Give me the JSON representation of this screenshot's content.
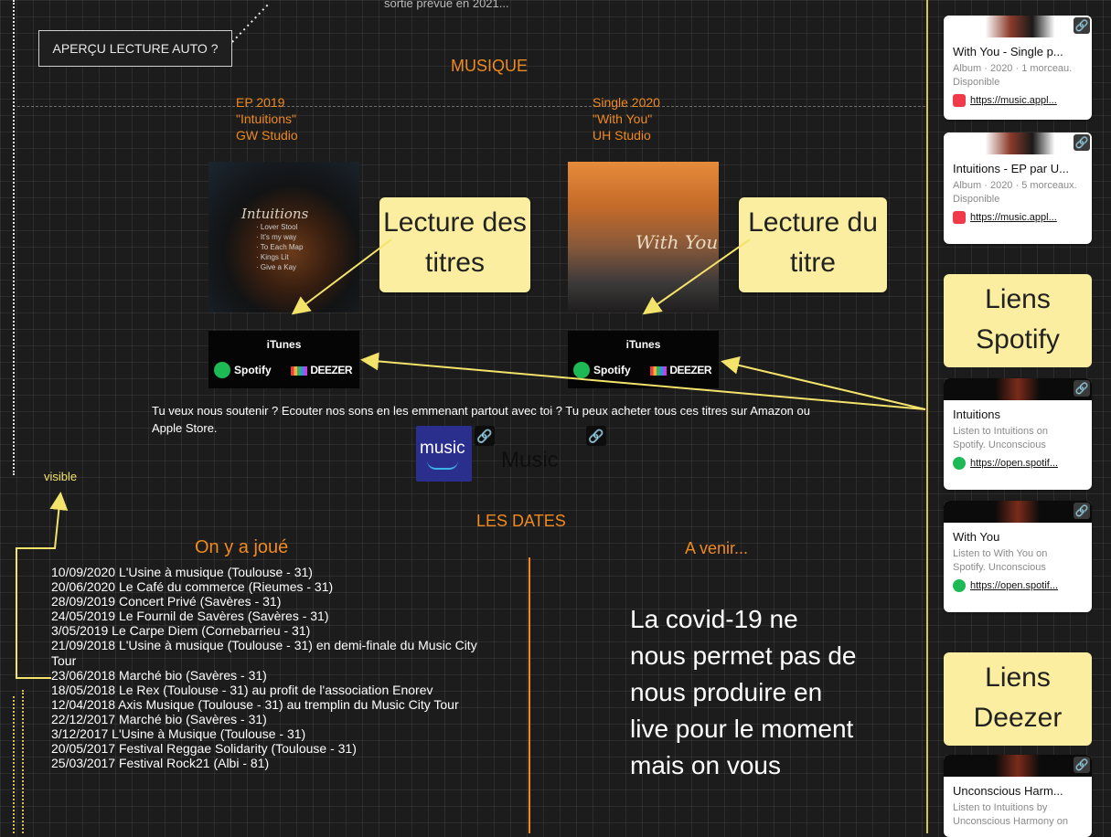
{
  "top_cut_text": "sortie prévue en 2021...",
  "autoplay": {
    "label": "APERÇU LECTURE AUTO ?"
  },
  "music": {
    "title": "MUSIQUE",
    "releases": [
      {
        "line1": "EP 2019",
        "line2": "\"Intuitions\"",
        "line3": "GW Studio",
        "cover_title": "Intuitions",
        "tracks": [
          "· Lover Stool",
          "· It's my way",
          "· To Each Map",
          "· Kings Lit",
          "· Give a Kay"
        ]
      },
      {
        "line1": "Single 2020",
        "line2": "\"With You\"",
        "line3": "UH Studio",
        "cover_title": "With You"
      }
    ],
    "stores": {
      "itunes": "iTunes",
      "spotify": "Spotify",
      "deezer": "DEEZER"
    },
    "callouts": {
      "left": "Lecture des titres",
      "right": "Lecture du titre"
    },
    "support_text": "Tu veux nous soutenir ? Ecouter nos sons en les emmenant partout avec toi ? Tu peux acheter tous ces titres sur Amazon ou Apple Store.",
    "amazon_label": "music",
    "apple_label": "Music"
  },
  "visible_label": "visible",
  "dates": {
    "title": "LES DATES",
    "played_title": "On y a joué",
    "upcoming_title": "A venir...",
    "played": [
      "10/09/2020 L'Usine à musique (Toulouse - 31)",
      "20/06/2020 Le Café du commerce (Rieumes - 31)",
      "28/09/2019 Concert Privé (Savères - 31)",
      "24/05/2019 Le Fournil de Savères (Savères - 31)",
      "3/05/2019 Le Carpe Diem (Cornebarrieu - 31)",
      "21/09/2018 L'Usine à musique (Toulouse - 31) en demi-finale du Music City Tour",
      "23/06/2018 Marché bio (Savères - 31)",
      "18/05/2018 Le Rex (Toulouse - 31) au profit de l'association Enorev",
      "12/04/2018 Axis Musique (Toulouse - 31) au tremplin du Music City Tour",
      "22/12/2017 Marché bio (Savères - 31)",
      "3/12/2017 L'Usine à Musique (Toulouse - 31)",
      "20/05/2017 Festival Reggae Solidarity (Toulouse - 31)",
      "25/03/2017 Festival Rock21 (Albi - 81)"
    ],
    "covid_text": "La covid-19 ne nous permet pas de nous produire en live pour le moment mais on vous"
  },
  "sidebar": {
    "cards_top": [
      {
        "title": "With You - Single p...",
        "desc": "Album · 2020 · 1 morceau. Disponible",
        "url": "https://music.appl..."
      },
      {
        "title": "Intuitions - EP par U...",
        "desc": "Album · 2020 · 5 morceaux. Disponible",
        "url": "https://music.appl..."
      }
    ],
    "callout_spotify": "Liens Spotify",
    "cards_spotify": [
      {
        "title": "Intuitions",
        "desc": "Listen to Intuitions on Spotify. Unconscious",
        "url": "https://open.spotif..."
      },
      {
        "title": "With You",
        "desc": "Listen to With You on Spotify. Unconscious",
        "url": "https://open.spotif..."
      }
    ],
    "callout_deezer": "Liens Deezer",
    "card_deezer": {
      "title": "Unconscious Harm...",
      "desc": "Listen to Intuitions by Unconscious Harmony on"
    }
  },
  "colors": {
    "accent": "#f08a1e",
    "callout": "#fbeea0",
    "guide": "#d9c24a"
  }
}
